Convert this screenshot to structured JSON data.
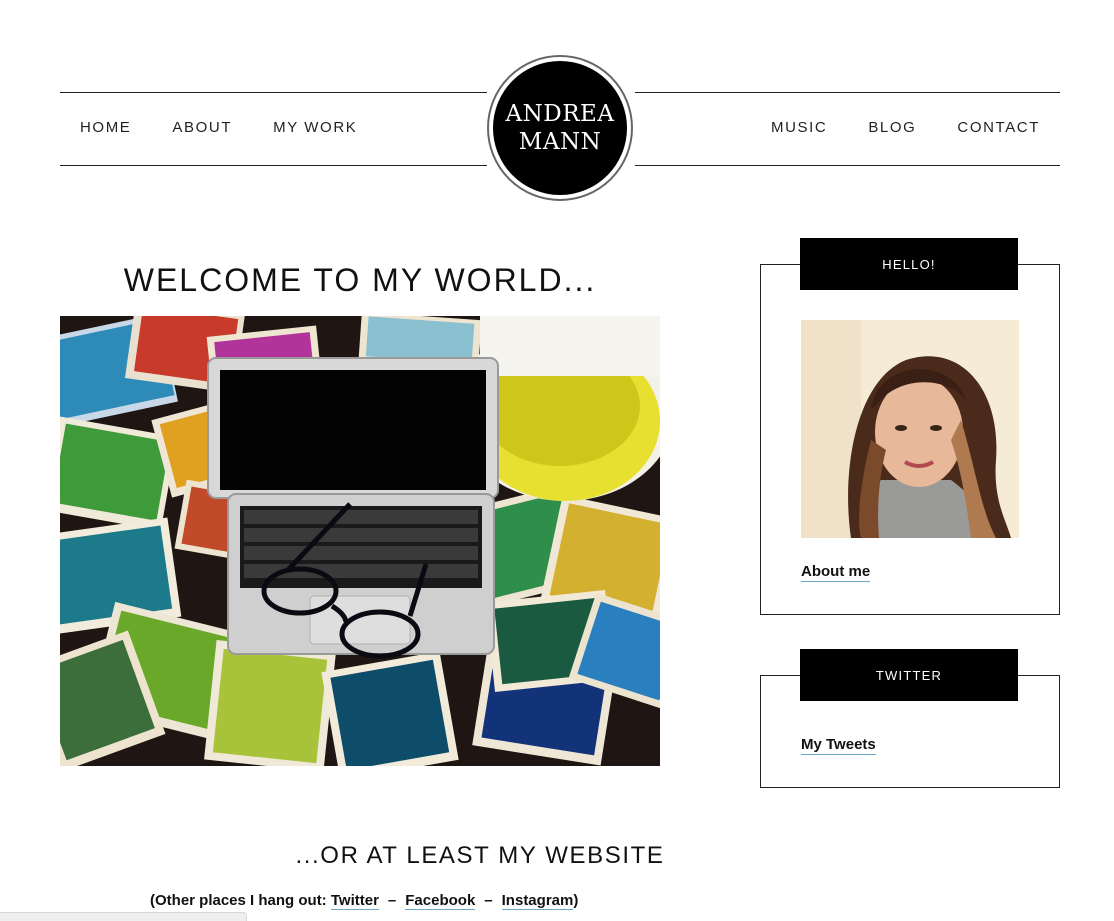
{
  "brand": {
    "logo_line1": "ANDREA",
    "logo_line2": "MANN"
  },
  "nav_left": [
    "HOME",
    "ABOUT",
    "MY WORK"
  ],
  "nav_right": [
    "MUSIC",
    "BLOG",
    "CONTACT"
  ],
  "main": {
    "heading": "WELCOME TO MY WORLD...",
    "subheading": "...OR AT LEAST MY WEBSITE",
    "others_prefix": "(Other places I hang out: ",
    "others_links": [
      "Twitter",
      "Facebook",
      "Instagram"
    ],
    "others_separator": "–",
    "others_suffix": ")"
  },
  "sidebar": {
    "hello_title": "HELLO!",
    "about_link": "About me",
    "twitter_title": "TWITTER",
    "tweets_link": "My Tweets"
  },
  "colors": {
    "accent_underline": "#6aa9c9",
    "widget_title_bg": "#000000",
    "text": "#111111"
  }
}
